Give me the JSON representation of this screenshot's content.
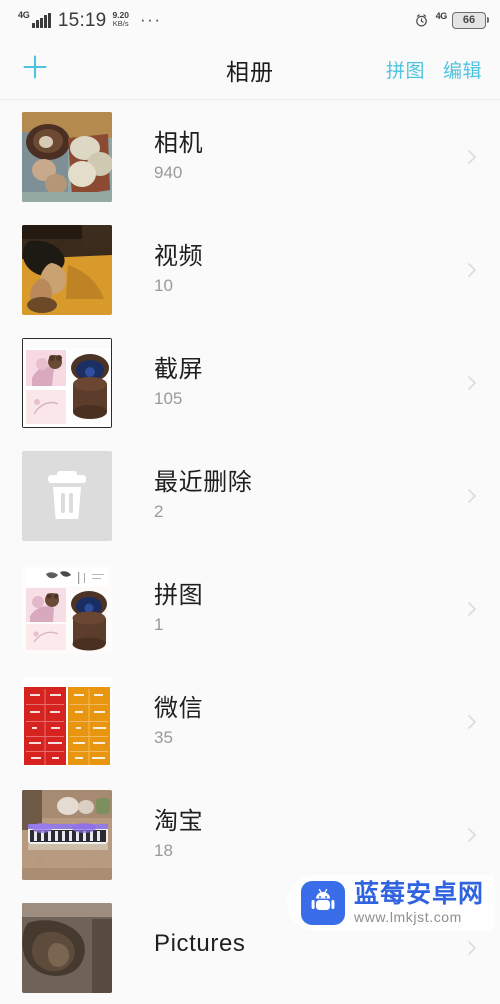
{
  "status_bar": {
    "network_left": "4G",
    "time": "15:19",
    "speed_value": "9.20",
    "speed_unit": "KB/s",
    "overflow": "···",
    "alarm_icon": "alarm-clock-icon",
    "network_right": "4G",
    "battery_level": "66"
  },
  "header": {
    "add_icon": "plus-icon",
    "title": "相册",
    "collage_label": "拼图",
    "edit_label": "编辑",
    "accent_color": "#4ec3e0"
  },
  "albums": [
    {
      "label": "相机",
      "count": "940",
      "thumb": "photo-mushrooms-in-bowl"
    },
    {
      "label": "视频",
      "count": "10",
      "thumb": "photo-legs-on-yellow-floor"
    },
    {
      "label": "截屏",
      "count": "105",
      "thumb": "photo-screenshot-music-box"
    },
    {
      "label": "最近删除",
      "count": "2",
      "thumb": "trash-icon"
    },
    {
      "label": "拼图",
      "count": "1",
      "thumb": "photo-collage-music-box"
    },
    {
      "label": "微信",
      "count": "35",
      "thumb": "photo-red-orange-coupons"
    },
    {
      "label": "淘宝",
      "count": "18",
      "thumb": "photo-purple-keyboard-piano"
    },
    {
      "label": "Pictures",
      "count": "",
      "thumb": "photo-dark-stone-figure"
    }
  ],
  "chevron_icon": "chevron-right-icon",
  "watermark": {
    "logo_icon": "android-robot-icon",
    "name": "蓝莓安卓网",
    "url": "www.lmkjst.com"
  }
}
